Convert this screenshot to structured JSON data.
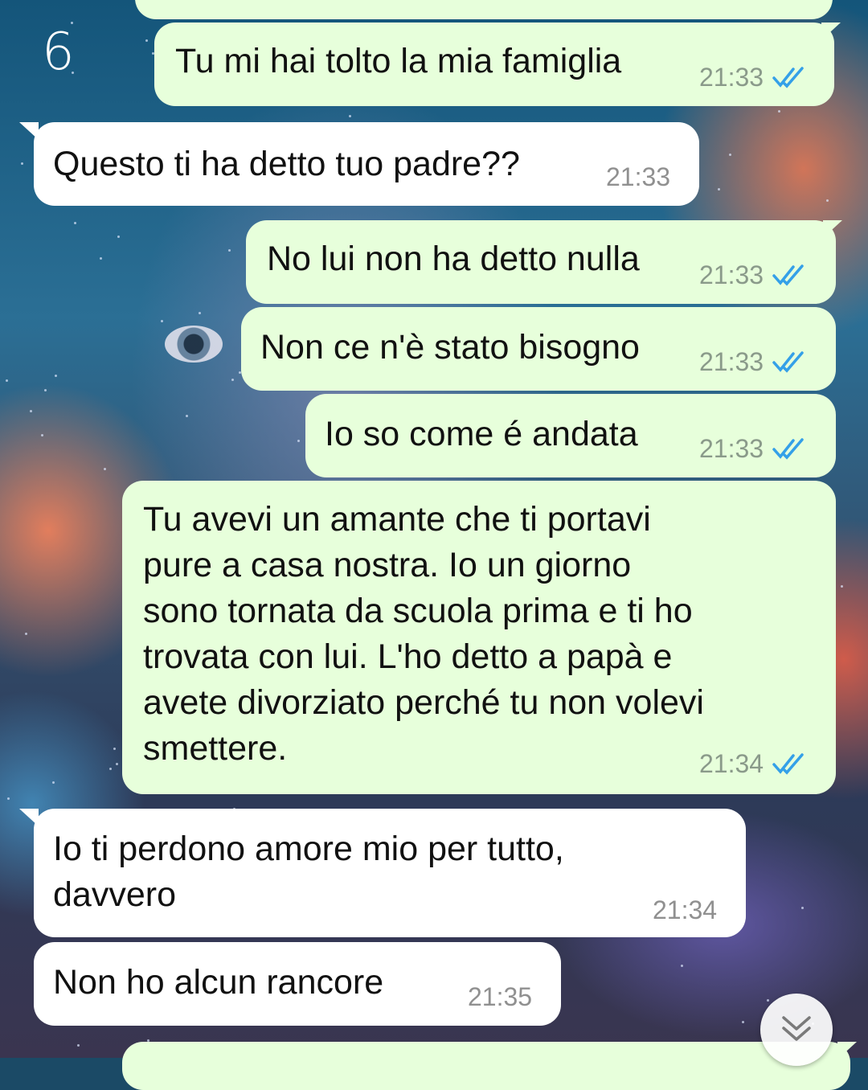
{
  "page_mark": "6",
  "messages": [
    {
      "id": "m1",
      "dir": "out",
      "text": "Tu mi hai tolto la mia famiglia",
      "time": "21:33",
      "status": "read"
    },
    {
      "id": "m2",
      "dir": "in",
      "text": "Questo ti ha detto tuo padre??",
      "time": "21:33"
    },
    {
      "id": "m3",
      "dir": "out",
      "text": "No lui non ha detto nulla",
      "time": "21:33",
      "status": "read"
    },
    {
      "id": "m4",
      "dir": "out",
      "text": "Non ce n'è stato bisogno",
      "time": "21:33",
      "status": "read"
    },
    {
      "id": "m5",
      "dir": "out",
      "text": "Io so come é andata",
      "time": "21:33",
      "status": "read"
    },
    {
      "id": "m6",
      "dir": "out",
      "lines": [
        "Tu avevi un amante che ti portavi",
        "pure a casa nostra. Io un giorno",
        "sono tornata da scuola prima e ti ho",
        "trovata con lui. L'ho detto a papà e",
        "avete divorziato perché tu non volevi",
        "smettere."
      ],
      "time": "21:34",
      "status": "read"
    },
    {
      "id": "m7",
      "dir": "in",
      "lines": [
        "Io ti perdono amore mio per tutto,",
        "davvero"
      ],
      "time": "21:34"
    },
    {
      "id": "m8",
      "dir": "in",
      "text": "Non ho alcun rancore",
      "time": "21:35"
    }
  ],
  "scroll_down_icon": "chevron-double-down-icon",
  "read_ticks_icon": "double-check-icon",
  "colors": {
    "outgoing_bubble": "#e7ffdb",
    "incoming_bubble": "#ffffff",
    "read_tick": "#34a0e8",
    "time_text": "#8a9a8a"
  }
}
